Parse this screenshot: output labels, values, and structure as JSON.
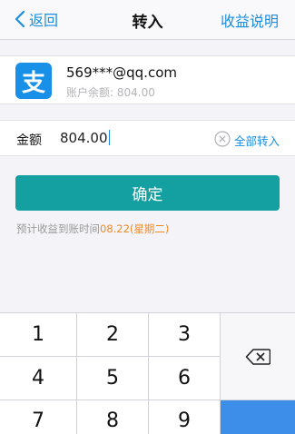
{
  "nav": {
    "back_label": "返回",
    "title": "转入",
    "right_label": "收益说明"
  },
  "account": {
    "logo_char": "支",
    "email": "569***@qq.com",
    "balance_text": "账户余额: 804.00"
  },
  "amount": {
    "label": "金额",
    "value": "804.00",
    "transfer_all_label": "全部转入"
  },
  "confirm_label": "确定",
  "hint": {
    "text": "预计收益到账时间",
    "date": "08.22(星期二)"
  },
  "keypad": {
    "keys": [
      "1",
      "2",
      "3",
      "4",
      "5",
      "6",
      "7",
      "8",
      "9"
    ]
  },
  "colors": {
    "accent_blue": "#1a8ee0",
    "confirm_green": "#14a0a0",
    "date_orange": "#f08a24"
  }
}
